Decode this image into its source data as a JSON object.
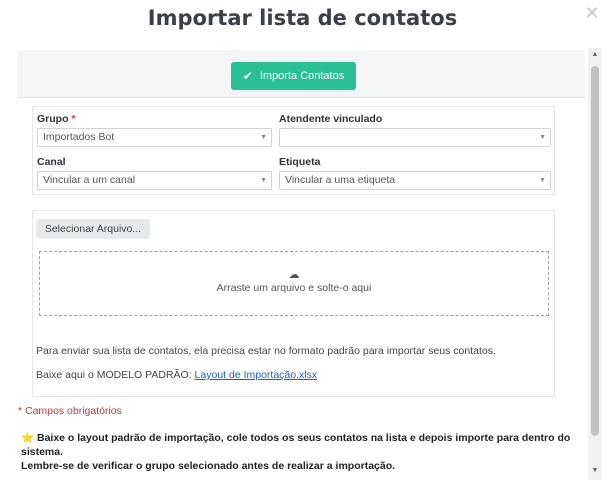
{
  "modal": {
    "title": "Importar lista de contatos",
    "close_glyph": "✕"
  },
  "import_bar": {
    "button_label": "Importa Contatos",
    "button_icon": "check-icon",
    "button_color": "#2bbf95"
  },
  "fields": {
    "grupo": {
      "label": "Grupo",
      "required_mark": "*",
      "value": "Importados Bot"
    },
    "atendente": {
      "label": "Atendente vinculado",
      "value": ""
    },
    "canal": {
      "label": "Canal",
      "value": "Vincular a um canal"
    },
    "etiqueta": {
      "label": "Etiqueta",
      "value": "Vincular a uma etiqueta"
    }
  },
  "upload": {
    "file_button_label": "Selecionar Arquivo...",
    "dropzone_icon": "cloud-upload-icon",
    "dropzone_text": "Arraste um arquivo e solte-o aqui",
    "info_text": "Para enviar sua lista de contatos, ela precisa estar no formato padrão para importar seus contatos.",
    "download_prefix": "Baixe aqui o MODELO PADRÃO:",
    "download_link": "Layout de Importação.xlsx"
  },
  "footer": {
    "required_note": "* Campos obrigatórios",
    "tip_icon": "star-icon",
    "tip_line1": "Baixe o layout padrão de importação, cole todos os seus contatos na lista e depois importe para dentro do sistema.",
    "tip_line2": "Lembre-se de verificar o grupo selecionado antes de realizar a importação."
  }
}
